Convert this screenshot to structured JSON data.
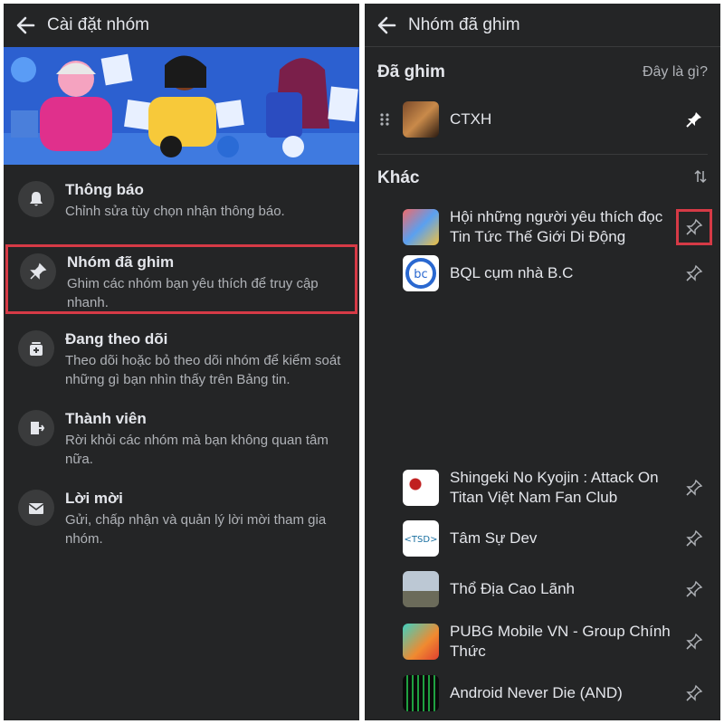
{
  "left": {
    "header": {
      "title": "Cài đặt nhóm"
    },
    "items": [
      {
        "title": "Thông báo",
        "desc": "Chỉnh sửa tùy chọn nhận thông báo."
      },
      {
        "title": "Nhóm đã ghim",
        "desc": "Ghim các nhóm bạn yêu thích để truy cập nhanh."
      },
      {
        "title": "Đang theo dõi",
        "desc": "Theo dõi hoặc bỏ theo dõi nhóm để kiểm soát những gì bạn nhìn thấy trên Bảng tin."
      },
      {
        "title": "Thành viên",
        "desc": "Rời khỏi các nhóm mà bạn không quan tâm nữa."
      },
      {
        "title": "Lời mời",
        "desc": "Gửi, chấp nhận và quản lý lời mời tham gia nhóm."
      }
    ]
  },
  "right": {
    "header": {
      "title": "Nhóm đã ghim"
    },
    "pinned_section": {
      "title": "Đã ghim",
      "link": "Đây là gì?"
    },
    "pinned": [
      {
        "name": "CTXH"
      }
    ],
    "other_section": {
      "title": "Khác"
    },
    "others": [
      {
        "name": "Hội những người yêu thích đọc Tin Tức Thế Giới Di Động"
      },
      {
        "name": "BQL cụm nhà B.C"
      },
      {
        "name": "Shingeki No Kyojin : Attack On Titan Việt Nam Fan Club"
      },
      {
        "name": "Tâm Sự Dev"
      },
      {
        "name": "Thổ Địa Cao Lãnh"
      },
      {
        "name": "PUBG Mobile VN - Group Chính Thức"
      },
      {
        "name": "Android Never Die (AND)"
      }
    ]
  },
  "colors": {
    "background": "#242526",
    "highlight": "#d63a46",
    "text": "#e4e6eb",
    "secondary": "#b0b3b8"
  }
}
